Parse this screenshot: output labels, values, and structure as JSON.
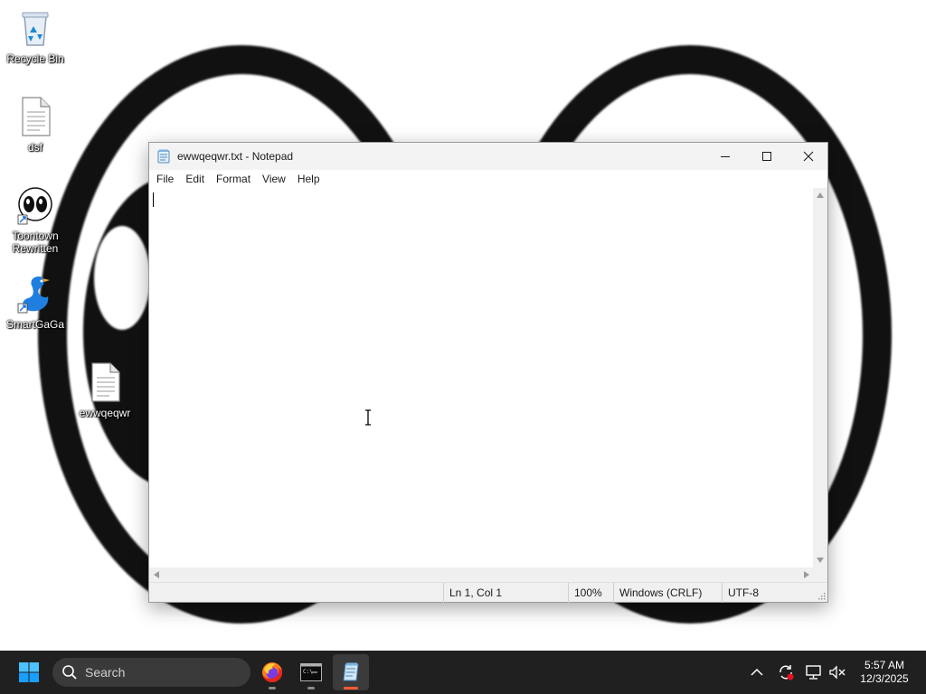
{
  "desktop": {
    "icons": [
      {
        "label": "Recycle Bin",
        "icon": "recycle-bin-icon"
      },
      {
        "label": "dsf",
        "icon": "text-file-icon"
      },
      {
        "label": "Toontown Rewritten",
        "icon": "toontown-icon"
      },
      {
        "label": "SmartGaGa",
        "icon": "smartgaga-icon"
      },
      {
        "label": "ewwqeqwr",
        "icon": "text-file-icon"
      }
    ]
  },
  "notepad": {
    "title": "ewwqeqwr.txt - Notepad",
    "menu": [
      "File",
      "Edit",
      "Format",
      "View",
      "Help"
    ],
    "content": "",
    "status": {
      "position": "Ln 1, Col 1",
      "zoom": "100%",
      "line_ending": "Windows (CRLF)",
      "encoding": "UTF-8"
    }
  },
  "taskbar": {
    "search_placeholder": "Search",
    "apps": [
      {
        "name": "Firefox",
        "icon": "firefox-icon"
      },
      {
        "name": "Command Prompt",
        "icon": "terminal-icon"
      },
      {
        "name": "Notepad",
        "icon": "notepad-icon",
        "active": true
      }
    ],
    "clock": {
      "time": "5:57 AM",
      "date": "12/3/2025"
    }
  },
  "colors": {
    "taskbar_bg": "#202020",
    "accent": "#0078d4",
    "active_indicator": "#ff5a36"
  }
}
